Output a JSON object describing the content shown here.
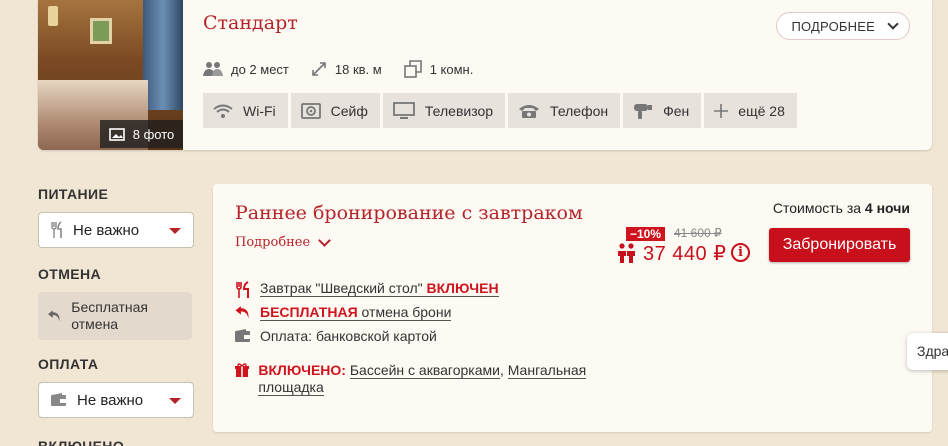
{
  "room": {
    "title": "Стандарт",
    "more_label": "ПОДРОБНЕЕ",
    "photos_label": "8 фото",
    "params": [
      "до 2 мест",
      "18 кв. м",
      "1 комн."
    ],
    "amenities": [
      "Wi-Fi",
      "Сейф",
      "Телевизор",
      "Телефон",
      "Фен",
      "ещё 28"
    ]
  },
  "sidebar": {
    "food": {
      "heading": "ПИТАНИЕ",
      "value": "Не важно"
    },
    "cancel": {
      "heading": "ОТМЕНА",
      "option": "Бесплатная отмена"
    },
    "payment": {
      "heading": "ОПЛАТА",
      "value": "Не важно"
    },
    "included": {
      "heading": "ВКЛЮЧЕНО"
    }
  },
  "offer": {
    "title": "Раннее бронирование с завтраком",
    "details_label": "Подробнее",
    "breakfast_text": "Завтрак \"Шведский стол\"",
    "breakfast_status": "ВКЛЮЧЕН",
    "cancel_status": "БЕСПЛАТНАЯ",
    "cancel_text": "отмена брони",
    "payment_text": "Оплата: банковской картой",
    "included_label": "ВКЛЮЧЕНО:",
    "included_item1": "Бассейн с аквагорками",
    "included_item2": "Мангальная площадка",
    "cost_prefix": "Стоимость за",
    "cost_nights": "4 ночи",
    "discount": "−10%",
    "old_price": "41 600 ₽",
    "price": "37 440 ₽",
    "book_label": "Забронировать"
  },
  "tooltip": {
    "text": "Здра"
  },
  "colors": {
    "accent": "#c8101c",
    "background": "#f1e6d4",
    "card": "#fdf9f3"
  }
}
